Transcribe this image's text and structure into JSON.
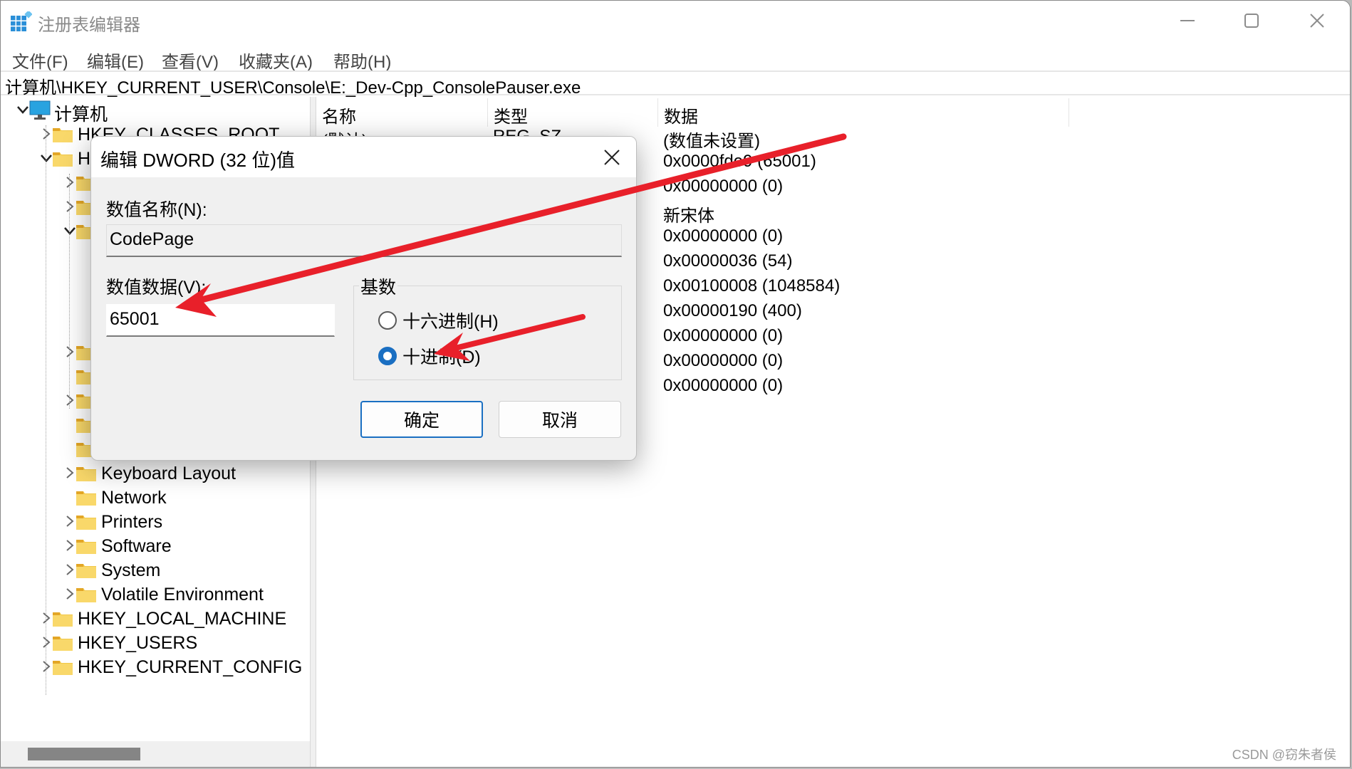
{
  "window": {
    "title": "注册表编辑器",
    "controls": [
      "minimize-icon",
      "maximize-icon",
      "close-icon"
    ]
  },
  "menu": [
    "文件(F)",
    "编辑(E)",
    "查看(V)",
    "收藏夹(A)",
    "帮助(H)"
  ],
  "address": "计算机\\HKEY_CURRENT_USER\\Console\\E:_Dev-Cpp_ConsolePauser.exe",
  "tree": [
    {
      "level": 0,
      "chevron": "down",
      "icon": "computer-icon",
      "label": "计算机"
    },
    {
      "level": 1,
      "chevron": "right",
      "icon": "folder-icon",
      "label": "HKEY_CLASSES_ROOT"
    },
    {
      "level": 1,
      "chevron": "down",
      "icon": "folder-icon",
      "label": "H"
    },
    {
      "level": 2,
      "chevron": "right",
      "icon": "folder-icon",
      "label": ""
    },
    {
      "level": 2,
      "chevron": "right",
      "icon": "folder-icon",
      "label": ""
    },
    {
      "level": 2,
      "chevron": "down",
      "icon": "folder-icon",
      "label": ""
    },
    {
      "level": 3,
      "chevron": "none",
      "icon": "folder-icon",
      "label": ""
    },
    {
      "level": 3,
      "chevron": "none",
      "icon": "folder-icon",
      "label": ""
    },
    {
      "level": 3,
      "chevron": "none",
      "icon": "folder-icon",
      "label": ""
    },
    {
      "level": 3,
      "chevron": "none",
      "icon": "folder-icon",
      "label": ""
    },
    {
      "level": 2,
      "chevron": "right",
      "icon": "folder-icon",
      "label": ""
    },
    {
      "level": 2,
      "chevron": "none",
      "icon": "folder-icon",
      "label": ""
    },
    {
      "level": 2,
      "chevron": "right",
      "icon": "folder-icon",
      "label": ""
    },
    {
      "level": 2,
      "chevron": "none",
      "icon": "folder-icon",
      "label": ""
    },
    {
      "level": 2,
      "chevron": "none",
      "icon": "folder-icon",
      "label": ""
    },
    {
      "level": 2,
      "chevron": "right",
      "icon": "folder-icon",
      "label": "Keyboard Layout"
    },
    {
      "level": 2,
      "chevron": "none",
      "icon": "folder-icon",
      "label": "Network"
    },
    {
      "level": 2,
      "chevron": "right",
      "icon": "folder-icon",
      "label": "Printers"
    },
    {
      "level": 2,
      "chevron": "right",
      "icon": "folder-icon",
      "label": "Software"
    },
    {
      "level": 2,
      "chevron": "right",
      "icon": "folder-icon",
      "label": "System"
    },
    {
      "level": 2,
      "chevron": "right",
      "icon": "folder-icon",
      "label": "Volatile Environment"
    },
    {
      "level": 1,
      "chevron": "right",
      "icon": "folder-icon",
      "label": "HKEY_LOCAL_MACHINE"
    },
    {
      "level": 1,
      "chevron": "right",
      "icon": "folder-icon",
      "label": "HKEY_USERS"
    },
    {
      "level": 1,
      "chevron": "right",
      "icon": "folder-icon",
      "label": "HKEY_CURRENT_CONFIG"
    }
  ],
  "list": {
    "columns": [
      "名称",
      "类型",
      "数据"
    ],
    "rows": [
      {
        "name": "(默认)",
        "type": "REG_SZ",
        "data": "(数值未设置)"
      },
      {
        "name": "",
        "type": "",
        "data": "0x0000fde9 (65001)"
      },
      {
        "name": "",
        "type": "",
        "data": "0x00000000 (0)"
      },
      {
        "name": "",
        "type": "",
        "data": "新宋体"
      },
      {
        "name": "",
        "type": "",
        "data": "0x00000000 (0)"
      },
      {
        "name": "",
        "type": "",
        "data": "0x00000036 (54)"
      },
      {
        "name": "",
        "type": "",
        "data": "0x00100008 (1048584)"
      },
      {
        "name": "",
        "type": "",
        "data": "0x00000190 (400)"
      },
      {
        "name": "",
        "type": "",
        "data": "0x00000000 (0)"
      },
      {
        "name": "",
        "type": "",
        "data": "0x00000000 (0)"
      },
      {
        "name": "",
        "type": "",
        "data": "0x00000000 (0)"
      }
    ]
  },
  "dialog": {
    "title": "编辑 DWORD (32 位)值",
    "name_label": "数值名称(N):",
    "name_value": "CodePage",
    "data_label": "数值数据(V):",
    "data_value": "65001",
    "base_label": "基数",
    "radio_hex": "十六进制(H)",
    "radio_dec": "十进制(D)",
    "selected_base": "dec",
    "ok": "确定",
    "cancel": "取消"
  },
  "annotation_color": "#e8202a",
  "accent_color": "#1a6fc2",
  "watermark": "CSDN @窃朱者侯"
}
